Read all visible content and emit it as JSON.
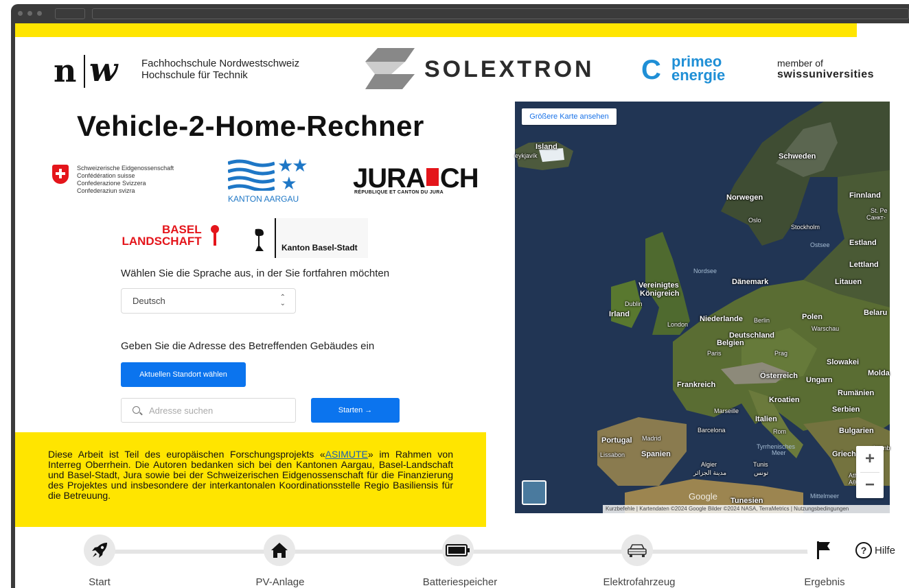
{
  "header": {
    "fhnw_name": "Fachhochschule Nordwestschweiz",
    "fhnw_school": "Hochschule für Technik",
    "solextron": "SOLEXTRON",
    "primeo_line1": "primeo",
    "primeo_line2": "energie",
    "member_of": "member of",
    "swissuniversities": "swissuniversities"
  },
  "title": "Vehicle-2-Home-Rechner",
  "partners": {
    "swiss_lines": [
      "Schweizerische Eidgenossenschaft",
      "Confédération suisse",
      "Confederazione Svizzera",
      "Confederaziun svizra"
    ],
    "aargau": "KANTON AARGAU",
    "jura": "JURA",
    "jura_ch": "CH",
    "jura_sub": "RÉPUBLIQUE ET CANTON DU JURA",
    "basel_land_1": "BASEL",
    "basel_land_2": "LANDSCHAFT",
    "basel_stadt": "Kanton Basel-Stadt"
  },
  "language": {
    "prompt": "Wählen Sie die Sprache aus, in der Sie fortfahren möchten",
    "selected": "Deutsch"
  },
  "address": {
    "prompt": "Geben Sie die Adresse des Betreffenden Gebäudes ein",
    "locate_button": "Aktuellen Standort wählen",
    "search_placeholder": "Adresse suchen",
    "start_button": "Starten →"
  },
  "info": {
    "before_link": "Diese Arbeit ist Teil des europäischen Forschungsprojekts «",
    "link": "ASIMUTE",
    "after_link": "» im Rahmen von Interreg Oberrhein. Die Autoren bedanken sich bei den Kantonen Aargau, Basel-Landschaft und Basel-Stadt, Jura sowie bei der Schweizerischen Eidgenossenschaft für die Finanzierung  des Projektes und insbesondere der interkantonalen Koordinationsstelle Regio Basiliensis für die Betreuung."
  },
  "map": {
    "larger_map": "Größere Karte ansehen",
    "google": "Google",
    "attribution": "Kurzbefehle | Kartendaten ©2024 Google Bilder ©2024 NASA, TerraMetrics | Nutzungsbedingungen",
    "zoom_in": "+",
    "zoom_out": "−",
    "labels": {
      "island": "Island",
      "reykjavik": "eykjavík",
      "schweden": "Schweden",
      "finnland": "Finnland",
      "norwegen": "Norwegen",
      "oslo": "Oslo",
      "stockholm": "Stockholm",
      "stpe": "St. Pe",
      "sankt": "Санкт-",
      "estland": "Estland",
      "ostsee": "Ostsee",
      "lettland": "Lettland",
      "nordsee": "Nordsee",
      "uk1": "Vereinigtes",
      "uk2": "Königreich",
      "dublin": "Dublin",
      "irland": "Irland",
      "daenemark": "Dänemark",
      "litauen": "Litauen",
      "london": "London",
      "niederlande": "Niederlande",
      "berlin": "Berlin",
      "polen": "Polen",
      "belaru": "Belaru",
      "warschau": "Warschau",
      "deutschland": "Deutschland",
      "belgien": "Belgien",
      "paris": "Paris",
      "prag": "Prag",
      "slowakei": "Slowakei",
      "oesterreich": "Österreich",
      "ungarn": "Ungarn",
      "molda": "Molda",
      "frankreich": "Frankreich",
      "rumaenien": "Rumänien",
      "kroatien": "Kroatien",
      "serbien": "Serbien",
      "marseille": "Marseille",
      "italien": "Italien",
      "barcelona": "Barcelona",
      "rom": "Rom",
      "bulgarien": "Bulgarien",
      "portugal": "Portugal",
      "madrid": "Madrid",
      "tyrr1": "Tyrrhenisches",
      "tyrr2": "Meer",
      "griechenland": "Griechenlan",
      "lissabon": "Lissabon",
      "spanien": "Spanien",
      "algier": "Algier",
      "algier_ar": "مدينة الجزائر",
      "tunis": "Tunis",
      "tunis_ar": "تونس",
      "athen": "Athen",
      "athen_gr": "Αθήνα",
      "tunesien": "Tunesien",
      "mittelmeer": "Mittelmeer",
      "istanb": "Istanb"
    }
  },
  "steps": [
    {
      "label": "Start",
      "icon": "rocket-icon"
    },
    {
      "label": "PV-Anlage",
      "icon": "house-icon"
    },
    {
      "label": "Batteriespeicher",
      "icon": "battery-icon"
    },
    {
      "label": "Elektrofahrzeug",
      "icon": "car-icon"
    },
    {
      "label": "Ergebnis",
      "icon": "flag-icon"
    }
  ],
  "help": "Hilfe",
  "colors": {
    "accent_yellow": "#ffe500",
    "primary_blue": "#0b74ee",
    "primeo_blue": "#1f8fd6"
  }
}
